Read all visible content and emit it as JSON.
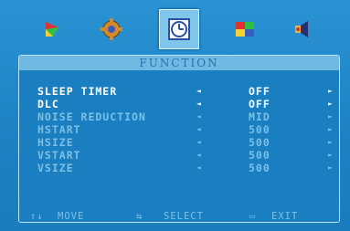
{
  "menu_tabs": [
    {
      "name": "picture",
      "icon": "color-flag-icon"
    },
    {
      "name": "adjust",
      "icon": "gear-icon"
    },
    {
      "name": "function",
      "icon": "clock-icon",
      "selected": true
    },
    {
      "name": "color",
      "icon": "color-grid-icon"
    },
    {
      "name": "audio",
      "icon": "speaker-icon"
    }
  ],
  "panel": {
    "title": "FUNCTION",
    "rows": [
      {
        "label": "SLEEP TIMER",
        "value": "OFF"
      },
      {
        "label": "DLC",
        "value": "OFF"
      },
      {
        "label": "NOISE REDUCTION",
        "value": "MID"
      },
      {
        "label": "HSTART",
        "value": "500"
      },
      {
        "label": "HSIZE",
        "value": "500"
      },
      {
        "label": "VSTART",
        "value": "500"
      },
      {
        "label": "VSIZE",
        "value": "500"
      }
    ],
    "left_arrow": "◄",
    "right_arrow": "►"
  },
  "footer": {
    "move_glyph": "↑↓",
    "move_label": "MOVE",
    "select_glyph": "⇆",
    "select_label": "SELECT",
    "exit_glyph": "▭",
    "exit_label": "EXIT"
  },
  "colors": {
    "background": "#1f86c6",
    "title_bar": "#6fb9e2",
    "active_text": "#ffffff",
    "dim_text": "#7cc0e6"
  }
}
